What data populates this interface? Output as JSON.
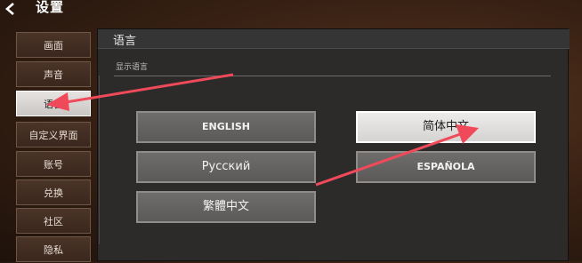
{
  "header": {
    "title": "设置",
    "back_icon": "chevron-left-icon"
  },
  "sidebar": {
    "items": [
      {
        "label": "画面"
      },
      {
        "label": "声音"
      },
      {
        "label": "语言"
      },
      {
        "label": "自定义界面"
      },
      {
        "label": "账号"
      },
      {
        "label": "兑换"
      },
      {
        "label": "社区"
      },
      {
        "label": "隐私"
      }
    ],
    "active_index": 2
  },
  "panel": {
    "title": "语言",
    "subheading": "显示语言",
    "languages": [
      {
        "label": "ENGLISH",
        "selected": false
      },
      {
        "label": "简体中文",
        "selected": true
      },
      {
        "label": "Русский",
        "selected": false
      },
      {
        "label": "ESPAÑOLA",
        "selected": false
      },
      {
        "label": "繁體中文",
        "selected": false
      }
    ]
  },
  "annotations": {
    "arrow_color": "#f04a5a"
  }
}
